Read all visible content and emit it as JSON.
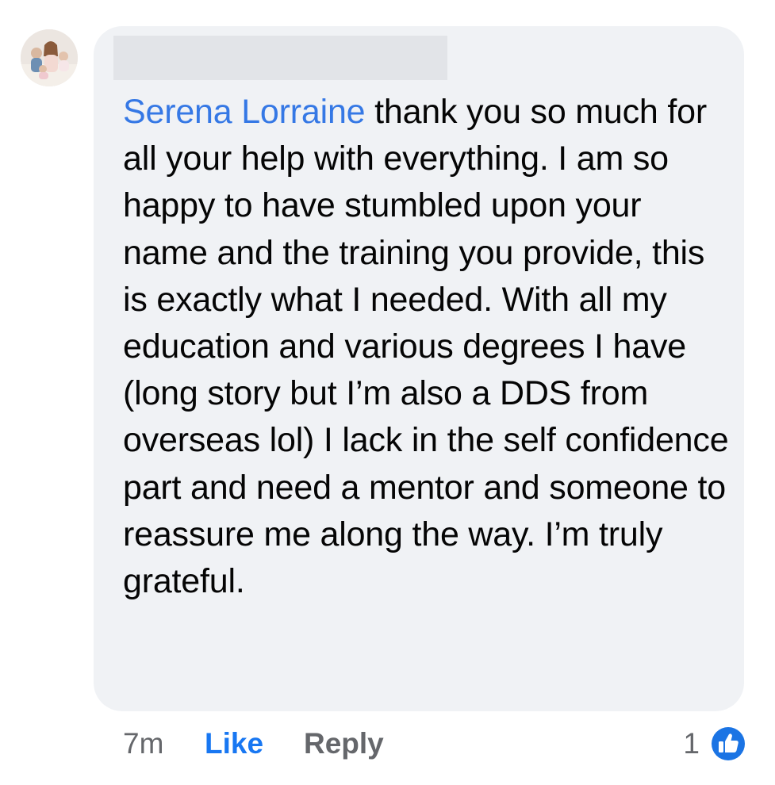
{
  "comment": {
    "author_redacted": true,
    "mention": "Serena Lorraine",
    "body": " thank you so much for all your help with everything. I am so happy to have stumbled upon your name and the training you provide, this is exactly what I needed. With all my education and various degrees I have (long story but I’m also a DDS from overseas lol) I lack in the self confidence part and need a mentor and someone to reassure me along the way. I’m truly grateful."
  },
  "actions": {
    "timestamp": "7m",
    "like_label": "Like",
    "reply_label": "Reply",
    "reaction_count": "1",
    "reaction_icon": "like-reaction-icon"
  },
  "colors": {
    "bubble": "#f0f2f5",
    "mention": "#3578e5",
    "like": "#1877f2",
    "muted": "#65676b",
    "text": "#050505"
  }
}
